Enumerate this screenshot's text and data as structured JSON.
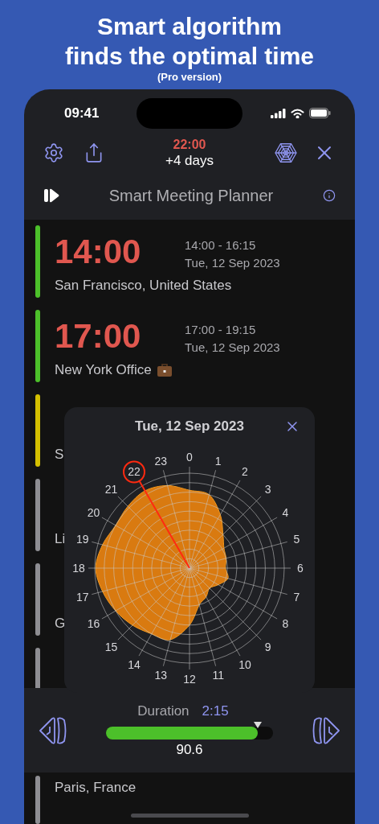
{
  "banner": {
    "title_lines": [
      "Smart algorithm",
      "finds the optimal time"
    ],
    "subtitle": "(Pro version)"
  },
  "status_bar": {
    "time": "09:41"
  },
  "toolbar": {
    "target_time": "22:00",
    "offset": "+4 days"
  },
  "title": "Smart Meeting Planner",
  "locations": [
    {
      "color": "#4cc02a",
      "kind": "place",
      "time": "14:00",
      "range": "14:00 - 16:15",
      "date": "Tue, 12 Sep 2023",
      "name": "San Francisco, United States"
    },
    {
      "color": "#4cc02a",
      "kind": "office",
      "time": "17:00",
      "range": "17:00 - 19:15",
      "date": "Tue, 12 Sep 2023",
      "name": "New York Office"
    },
    {
      "color": "#d4c000",
      "kind": "place",
      "name": "S"
    },
    {
      "color": "#8e8e93",
      "kind": "place",
      "name": "Li"
    },
    {
      "color": "#8e8e93",
      "kind": "place",
      "name": "G"
    },
    {
      "color": "#8e8e93"
    }
  ],
  "day_popup": {
    "title": "Tue, 12 Sep 2023",
    "hours": [
      {
        "label": "0",
        "selected": false
      },
      {
        "label": "23",
        "selected": false
      },
      {
        "label": "1",
        "selected": false
      },
      {
        "label": "22",
        "selected": true
      },
      {
        "label": "2",
        "selected": false
      },
      {
        "label": "21",
        "selected": false
      },
      {
        "label": "3",
        "selected": false
      },
      {
        "label": "20",
        "selected": false
      },
      {
        "label": "4",
        "selected": false
      },
      {
        "label": "19",
        "selected": false
      },
      {
        "label": "5",
        "selected": false
      },
      {
        "label": "18",
        "selected": false
      },
      {
        "label": "6",
        "selected": false
      },
      {
        "label": "17",
        "selected": false
      },
      {
        "label": "7",
        "selected": false
      },
      {
        "label": "16",
        "selected": false
      },
      {
        "label": "8",
        "selected": false
      },
      {
        "label": "15",
        "selected": false
      },
      {
        "label": "9",
        "selected": false
      },
      {
        "label": "14",
        "selected": false
      },
      {
        "label": "10",
        "selected": false
      },
      {
        "label": "13",
        "selected": false
      },
      {
        "label": "11",
        "selected": false
      },
      {
        "label": "12",
        "selected": false
      }
    ]
  },
  "duration_panel": {
    "label": "Duration",
    "value": "2:15",
    "level": 0.91,
    "reading": "90.6"
  },
  "last_location": {
    "color": "#8e8e93",
    "name": "Paris, France"
  }
}
